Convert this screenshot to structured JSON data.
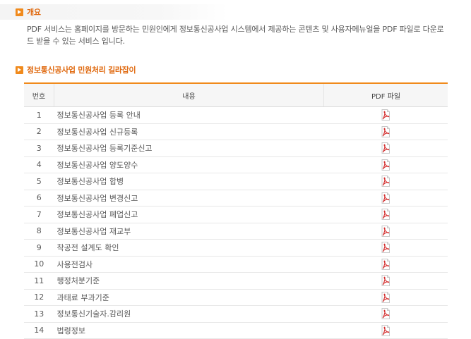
{
  "overview": {
    "title": "개요",
    "description": "PDF 서비스는 홈페이지를 방문하는 민원인에게 정보통신공사업 시스템에서 제공하는 콘텐츠 및 사용자메뉴얼을 PDF 파일로 다운로드 받을 수 있는 서비스 입니다."
  },
  "guide": {
    "title": "정보통신공사업 민원처리 길라잡이",
    "columns": {
      "num": "번호",
      "content": "내용",
      "pdf": "PDF 파일"
    },
    "rows": [
      {
        "num": "1",
        "content": "정보통신공사업  등록 안내"
      },
      {
        "num": "2",
        "content": "정보통신공사업  신규등록"
      },
      {
        "num": "3",
        "content": "정보통신공사업  등록기준신고"
      },
      {
        "num": "4",
        "content": "정보통신공사업  양도양수"
      },
      {
        "num": "5",
        "content": "정보통신공사업  합병"
      },
      {
        "num": "6",
        "content": "정보통신공사업  변경신고"
      },
      {
        "num": "7",
        "content": "정보통신공사업  폐업신고"
      },
      {
        "num": "8",
        "content": "정보통신공사업  재교부"
      },
      {
        "num": "9",
        "content": "착공전 설계도 확인"
      },
      {
        "num": "10",
        "content": "사용전검사"
      },
      {
        "num": "11",
        "content": "행정처분기준"
      },
      {
        "num": "12",
        "content": "과태료 부과기준"
      },
      {
        "num": "13",
        "content": "정보통신기술자.감리원"
      },
      {
        "num": "14",
        "content": "법령정보"
      }
    ]
  },
  "colors": {
    "accent": "#f08a1c",
    "title": "#e06b12",
    "pdf_red": "#d32f2f"
  },
  "icons": {
    "section": "orange-arrow-icon",
    "download": "pdf-file-icon"
  }
}
